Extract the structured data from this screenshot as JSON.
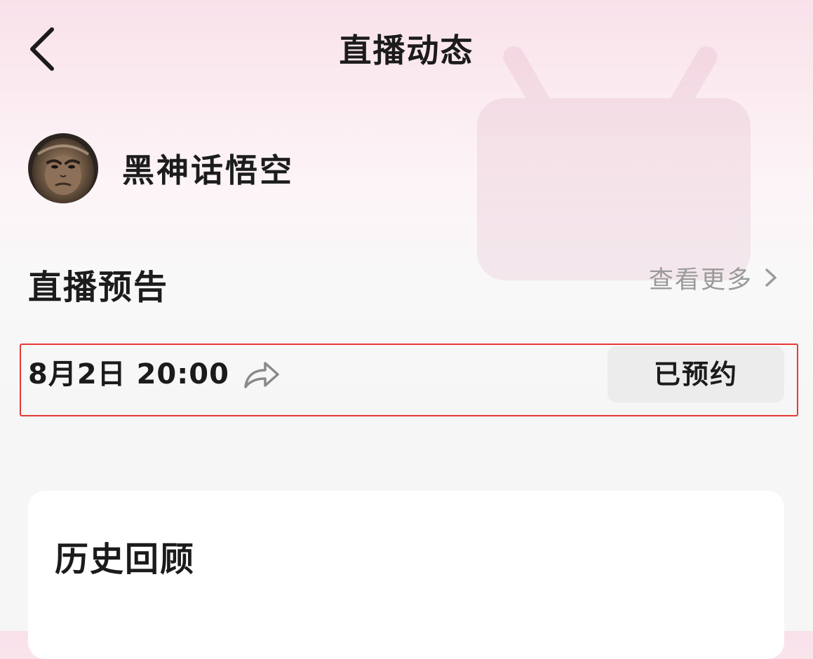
{
  "header": {
    "title": "直播动态",
    "back_icon": "chevron-left-icon"
  },
  "profile": {
    "name": "黑神话悟空",
    "avatar": "wukong-avatar"
  },
  "preview_section": {
    "title": "直播预告",
    "view_more_label": "查看更多",
    "view_more_icon": "chevron-right-icon"
  },
  "schedule": {
    "time": "8月2日 20:00",
    "share_icon": "share-arrow-icon",
    "reserve_label": "已预约"
  },
  "history": {
    "title": "历史回顾"
  },
  "colors": {
    "highlight_border": "#e53935",
    "muted_text": "#9a9a9a",
    "button_bg": "#ececec",
    "card_bg": "#ffffff"
  }
}
